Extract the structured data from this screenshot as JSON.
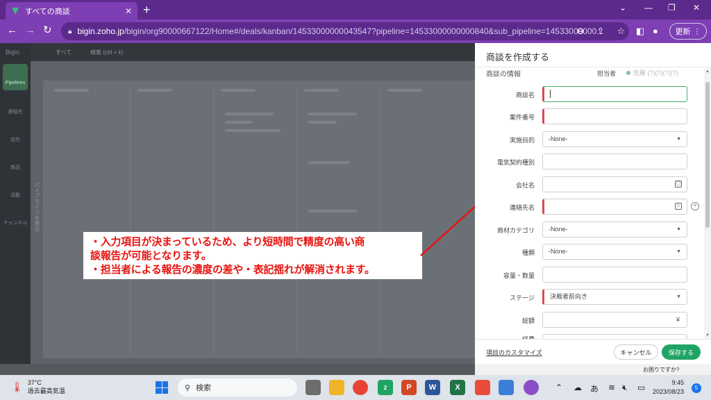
{
  "browser": {
    "tab_title": "すべての商談",
    "tab_close": "✕",
    "new_tab": "+",
    "url_host": "bigin.zoho.jp",
    "url_path": "/bigin/org90000667122/Home#/deals/kanban/14533000000043547?pipeline=14533000000000840&sub_pipeline=14533000000...",
    "update_label": "更新",
    "window_controls": [
      "⌄",
      "—",
      "❐",
      "✕"
    ]
  },
  "app": {
    "logo": "Bigin",
    "view_selector": "すべて",
    "search_placeholder": "検索 (ctrl + k)",
    "side_items": [
      "Pipelines",
      "連絡先",
      "会社",
      "商品",
      "活動",
      "チャンネル"
    ],
    "vertical_text": "パイプラインを表示"
  },
  "callout": {
    "line1": "・入力項目が決まっているため、より短時間で精度の高い商",
    "line2": "談報告が可能となります。",
    "line3": "・担当者による報告の濃度の差や・表記揺れが解消されます。"
  },
  "form": {
    "title": "商談を作成する",
    "section": "商談の情報",
    "owner_label": "担当者",
    "owner_value": "佐藤 (?)(?)(?)(?)",
    "fields": [
      {
        "label": "商談名",
        "value": ""
      },
      {
        "label": "案件番号",
        "value": ""
      },
      {
        "label": "実施目的",
        "value": "-None-"
      },
      {
        "label": "電気契約種別",
        "value": ""
      },
      {
        "label": "会社名",
        "value": ""
      },
      {
        "label": "連絡先名",
        "value": ""
      },
      {
        "label": "商材カテゴリ",
        "value": "-None-"
      },
      {
        "label": "種類",
        "value": "-None-"
      },
      {
        "label": "容量・数量",
        "value": ""
      },
      {
        "label": "ステージ",
        "value": "決裁者前向き"
      },
      {
        "label": "総額",
        "value": "",
        "suffix": "¥"
      },
      {
        "label": "経費",
        "value": ""
      }
    ],
    "customize_link": "項目のカスタマイズ",
    "cancel_label": "キャンセル",
    "save_label": "保存する",
    "help_label": "お困りですか?"
  },
  "taskbar": {
    "temperature": "37°C",
    "weather_text": "過去最高気温",
    "search_placeholder": "検索",
    "ime": "あ",
    "time": "9:45",
    "date": "2023/08/23",
    "notification_count": "5",
    "chat_badge": "2"
  },
  "colors": {
    "browser_tab": "#5b2a8c",
    "browser_toolbar": "#7d3fb3",
    "save_green": "#1fa463",
    "required_red": "#e0474c",
    "callout_red": "#e8130f"
  }
}
